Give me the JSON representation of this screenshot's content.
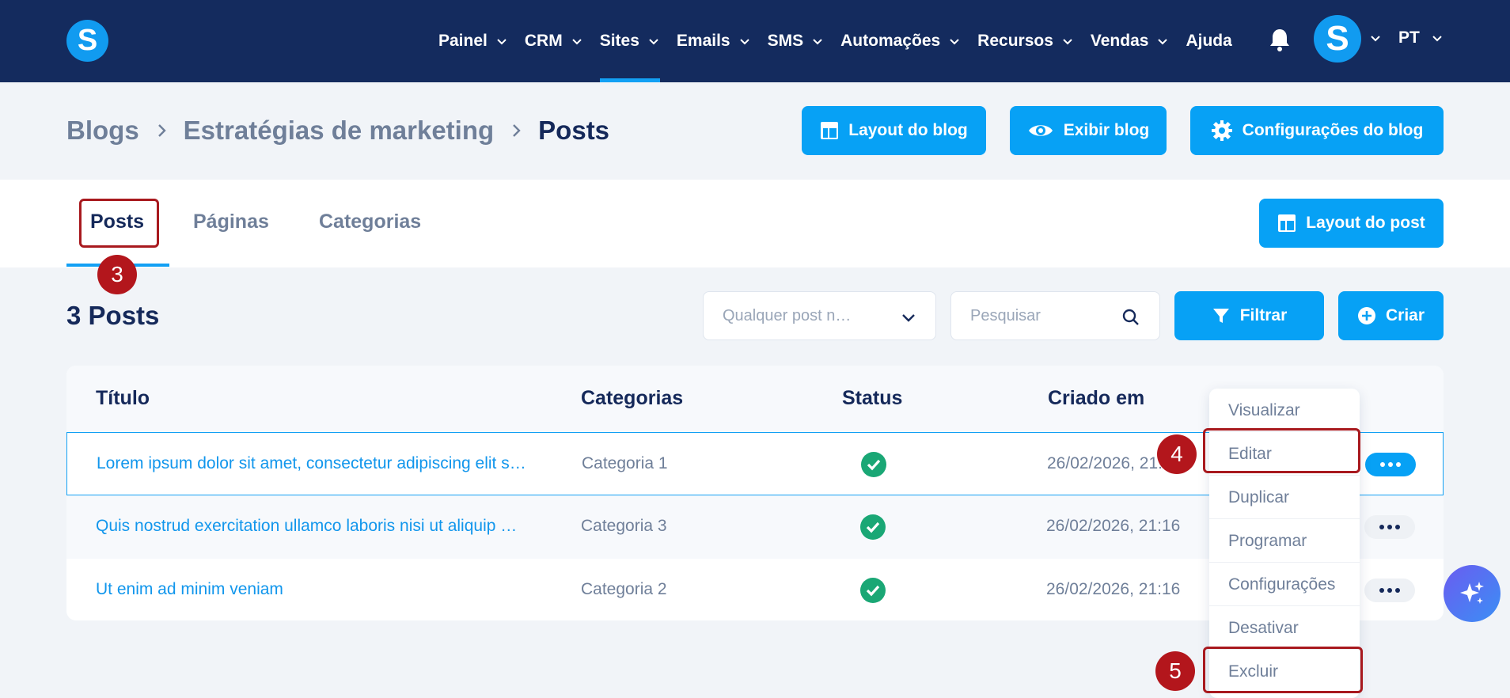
{
  "nav": {
    "items": [
      {
        "label": "Painel",
        "has_menu": true,
        "active": false
      },
      {
        "label": "CRM",
        "has_menu": true,
        "active": false
      },
      {
        "label": "Sites",
        "has_menu": true,
        "active": true
      },
      {
        "label": "Emails",
        "has_menu": true,
        "active": false
      },
      {
        "label": "SMS",
        "has_menu": true,
        "active": false
      },
      {
        "label": "Automações",
        "has_menu": true,
        "active": false
      },
      {
        "label": "Recursos",
        "has_menu": true,
        "active": false
      },
      {
        "label": "Vendas",
        "has_menu": true,
        "active": false
      },
      {
        "label": "Ajuda",
        "has_menu": false,
        "active": false
      }
    ],
    "logo_letter": "S",
    "avatar_letter": "S",
    "language": "PT"
  },
  "breadcrumb": {
    "items": [
      "Blogs",
      "Estratégias de marketing",
      "Posts"
    ]
  },
  "header_buttons": {
    "layout_blog": "Layout do blog",
    "view_blog": "Exibir blog",
    "blog_settings": "Configurações do blog"
  },
  "tabs": [
    {
      "label": "Posts",
      "active": true
    },
    {
      "label": "Páginas",
      "active": false
    },
    {
      "label": "Categorias",
      "active": false
    }
  ],
  "layout_post_button": "Layout do post",
  "annotations": [
    "3",
    "4",
    "5"
  ],
  "toolbar": {
    "count_label": "3 Posts",
    "select_value": "Qualquer post n…",
    "search_placeholder": "Pesquisar",
    "filter_label": "Filtrar",
    "create_label": "Criar"
  },
  "table": {
    "headers": [
      "Título",
      "Categorias",
      "Status",
      "Criado em"
    ],
    "rows": [
      {
        "title": "Lorem ipsum dolor sit amet, consectetur adipiscing elit s…",
        "category": "Categoria 1",
        "status": "published",
        "created": "26/02/2026, 21:"
      },
      {
        "title": "Quis nostrud exercitation ullamco laboris nisi ut aliquip …",
        "category": "Categoria 3",
        "status": "published",
        "created": "26/02/2026, 21:16"
      },
      {
        "title": "Ut enim ad minim veniam",
        "category": "Categoria 2",
        "status": "published",
        "created": "26/02/2026, 21:16"
      }
    ]
  },
  "menu": {
    "items": [
      "Visualizar",
      "Editar",
      "Duplicar",
      "Programar",
      "Configurações",
      "Desativar",
      "Excluir"
    ]
  },
  "colors": {
    "nav_bg": "#142b5e",
    "accent": "#07a1f5",
    "status_green": "#1aa775",
    "annotation_red": "#b3161c"
  }
}
